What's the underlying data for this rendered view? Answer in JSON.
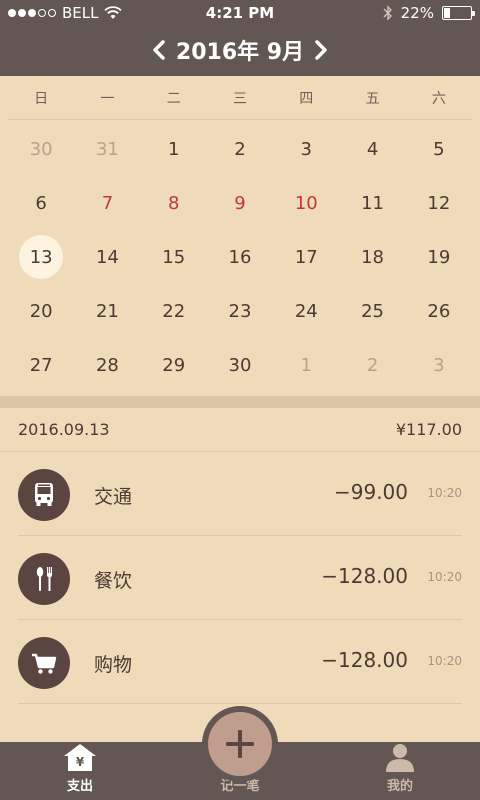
{
  "status_bar": {
    "carrier": "BELL",
    "time": "4:21 PM",
    "battery": "22%"
  },
  "month_nav": {
    "title": "2016年 9月"
  },
  "weekdays": [
    "日",
    "一",
    "二",
    "三",
    "四",
    "五",
    "六"
  ],
  "calendar": [
    {
      "day": "30",
      "state": "muted"
    },
    {
      "day": "31",
      "state": "muted"
    },
    {
      "day": "1",
      "state": "normal"
    },
    {
      "day": "2",
      "state": "normal"
    },
    {
      "day": "3",
      "state": "normal"
    },
    {
      "day": "4",
      "state": "normal"
    },
    {
      "day": "5",
      "state": "normal"
    },
    {
      "day": "6",
      "state": "normal"
    },
    {
      "day": "7",
      "state": "holiday"
    },
    {
      "day": "8",
      "state": "holiday"
    },
    {
      "day": "9",
      "state": "holiday"
    },
    {
      "day": "10",
      "state": "holiday"
    },
    {
      "day": "11",
      "state": "normal"
    },
    {
      "day": "12",
      "state": "normal"
    },
    {
      "day": "13",
      "state": "selected"
    },
    {
      "day": "14",
      "state": "normal"
    },
    {
      "day": "15",
      "state": "normal"
    },
    {
      "day": "16",
      "state": "normal"
    },
    {
      "day": "17",
      "state": "normal"
    },
    {
      "day": "18",
      "state": "normal"
    },
    {
      "day": "19",
      "state": "normal"
    },
    {
      "day": "20",
      "state": "normal"
    },
    {
      "day": "21",
      "state": "normal"
    },
    {
      "day": "22",
      "state": "normal"
    },
    {
      "day": "23",
      "state": "normal"
    },
    {
      "day": "24",
      "state": "normal"
    },
    {
      "day": "25",
      "state": "normal"
    },
    {
      "day": "26",
      "state": "normal"
    },
    {
      "day": "27",
      "state": "normal"
    },
    {
      "day": "28",
      "state": "normal"
    },
    {
      "day": "29",
      "state": "normal"
    },
    {
      "day": "30",
      "state": "normal"
    },
    {
      "day": "1",
      "state": "muted"
    },
    {
      "day": "2",
      "state": "muted"
    },
    {
      "day": "3",
      "state": "muted"
    }
  ],
  "summary": {
    "date": "2016.09.13",
    "total": "¥117.00"
  },
  "expenses": [
    {
      "category": "交通",
      "icon": "bus-icon",
      "amount": "−99.00",
      "time": "10:20"
    },
    {
      "category": "餐饮",
      "icon": "utensils-icon",
      "amount": "−128.00",
      "time": "10:20"
    },
    {
      "category": "购物",
      "icon": "shopping-cart-icon",
      "amount": "−128.00",
      "time": "10:20"
    }
  ],
  "tabbar": {
    "spend_label": "支出",
    "add_label": "记一笔",
    "me_label": "我的",
    "spend_icon_glyph": "¥"
  },
  "colors": {
    "header_bg": "#625752",
    "page_bg": "#efdab9",
    "holiday_red": "#c0393b",
    "icon_circle": "#5b4540",
    "fab_inner": "#c19d8e"
  }
}
